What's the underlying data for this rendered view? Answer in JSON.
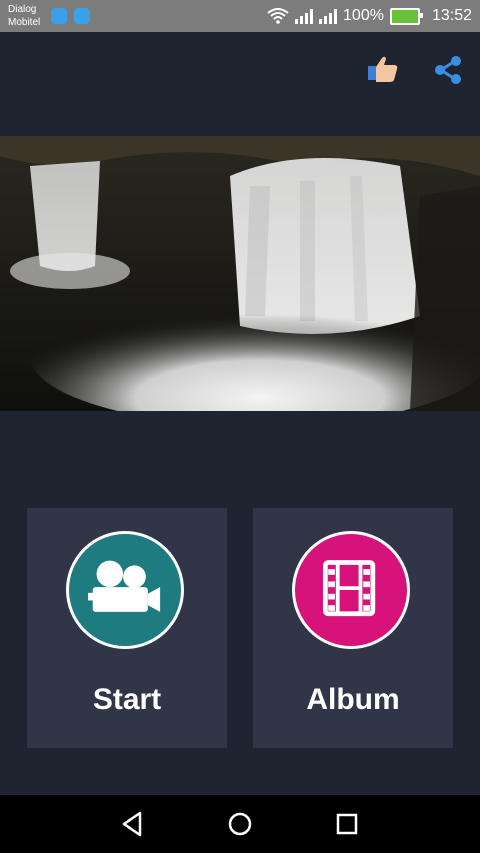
{
  "status_bar": {
    "carrier_line1": "Dialog",
    "carrier_line2": "Mobitel",
    "battery_percent": "100%",
    "time": "13:52",
    "icons": [
      "notification-icon",
      "notification-icon",
      "wifi-icon",
      "signal-icon",
      "signal-icon",
      "battery-charging-icon"
    ]
  },
  "toolbar": {
    "icons": [
      "thumbs-up-icon",
      "share-icon"
    ]
  },
  "main": {
    "start": {
      "label": "Start",
      "icon": "video-camera-icon",
      "color": "#1e7b80"
    },
    "album": {
      "label": "Album",
      "icon": "film-strip-icon",
      "color": "#d7127a"
    }
  },
  "nav": {
    "icons": [
      "back-icon",
      "home-icon",
      "recents-icon"
    ]
  },
  "colors": {
    "background": "#1f2431",
    "card": "#303648",
    "accent_share": "#3a8fe0"
  }
}
